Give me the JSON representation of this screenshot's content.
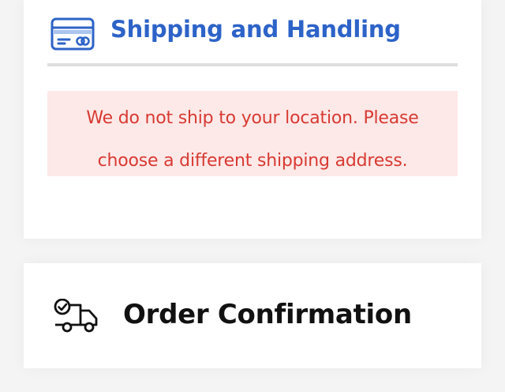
{
  "shipping_section": {
    "title": "Shipping and Handling",
    "icon": "credit-card-icon",
    "alert": {
      "line1": "We do not ship to your location. Please",
      "line2": "choose a different shipping address."
    }
  },
  "confirmation_section": {
    "title": "Order Confirmation",
    "icon": "delivery-truck-icon"
  },
  "colors": {
    "accent": "#2d63c8",
    "error_text": "#d83a32",
    "error_bg": "#fde9e8",
    "title_text": "#111111"
  }
}
